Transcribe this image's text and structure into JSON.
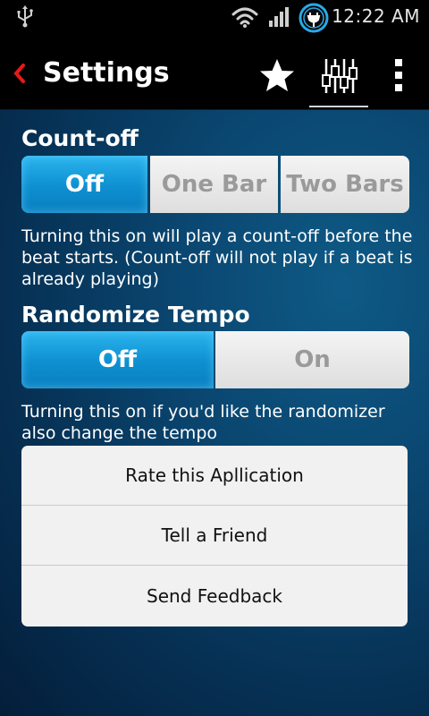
{
  "status_bar": {
    "time": "12:22 AM",
    "icons": [
      "usb-icon",
      "wifi-icon",
      "signal-icon",
      "battery-charging-icon"
    ]
  },
  "action_bar": {
    "title": "Settings",
    "icons": [
      "back-chevron-icon",
      "star-icon",
      "mixer-sliders-icon",
      "overflow-menu-icon"
    ]
  },
  "count_off": {
    "title": "Count-off",
    "options": [
      "Off",
      "One Bar",
      "Two Bars"
    ],
    "selected": "Off",
    "description": "Turning this on will play a count-off before the beat starts. (Count-off will not play if a beat is already playing)"
  },
  "randomize_tempo": {
    "title": "Randomize Tempo",
    "options": [
      "Off",
      "On"
    ],
    "selected": "Off",
    "description": "Turning this on if you'd like the randomizer also change the tempo"
  },
  "actions": [
    {
      "label": "Rate this Apllication"
    },
    {
      "label": "Tell a Friend"
    },
    {
      "label": "Send Feedback"
    }
  ],
  "colors": {
    "accent": "#1aa3e0",
    "back_arrow": "#e21b1b",
    "background": "#0a4670"
  }
}
